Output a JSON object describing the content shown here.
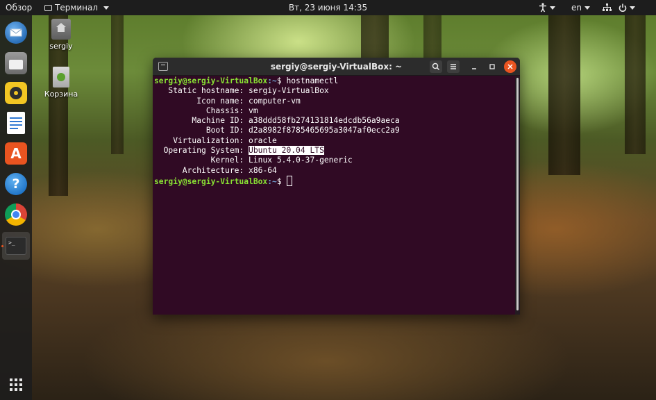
{
  "topbar": {
    "activities": "Обзор",
    "app_menu": "Терминал",
    "clock": "Вт, 23 июня  14:35",
    "language": "en"
  },
  "dock": {
    "apps": [
      {
        "name": "thunderbird-icon",
        "color": "#2a6fb8"
      },
      {
        "name": "files-icon",
        "color": "#7a7a7a"
      },
      {
        "name": "rhythmbox-icon",
        "color": "#f3c623"
      },
      {
        "name": "writer-icon",
        "color": "#2f78d2"
      },
      {
        "name": "software-icon",
        "color": "#e95420"
      },
      {
        "name": "help-icon",
        "color": "#2f8fd8"
      },
      {
        "name": "chrome-icon",
        "color": "#dd4b39"
      },
      {
        "name": "terminal-icon",
        "color": "#2b2b2b"
      }
    ],
    "show_apps": "show-applications-icon"
  },
  "desktop": {
    "home_label": "sergiy",
    "trash_label": "Корзина"
  },
  "terminal": {
    "title": "sergiy@sergiy-VirtualBox: ~",
    "prompt_user": "sergiy@sergiy-VirtualBox",
    "prompt_path": ":~",
    "command": "hostnamectl",
    "rows": [
      {
        "key": "   Static hostname:",
        "value": "sergiy-VirtualBox"
      },
      {
        "key": "         Icon name:",
        "value": "computer-vm"
      },
      {
        "key": "           Chassis:",
        "value": "vm"
      },
      {
        "key": "        Machine ID:",
        "value": "a38ddd58fb274131814edcdb56a9aeca"
      },
      {
        "key": "           Boot ID:",
        "value": "d2a8982f8785465695a3047af0ecc2a9"
      },
      {
        "key": "    Virtualization:",
        "value": "oracle"
      },
      {
        "key": "  Operating System:",
        "value": "Ubuntu 20.04 LTS"
      },
      {
        "key": "            Kernel:",
        "value": "Linux 5.4.0-37-generic"
      },
      {
        "key": "      Architecture:",
        "value": "x86-64"
      }
    ]
  }
}
